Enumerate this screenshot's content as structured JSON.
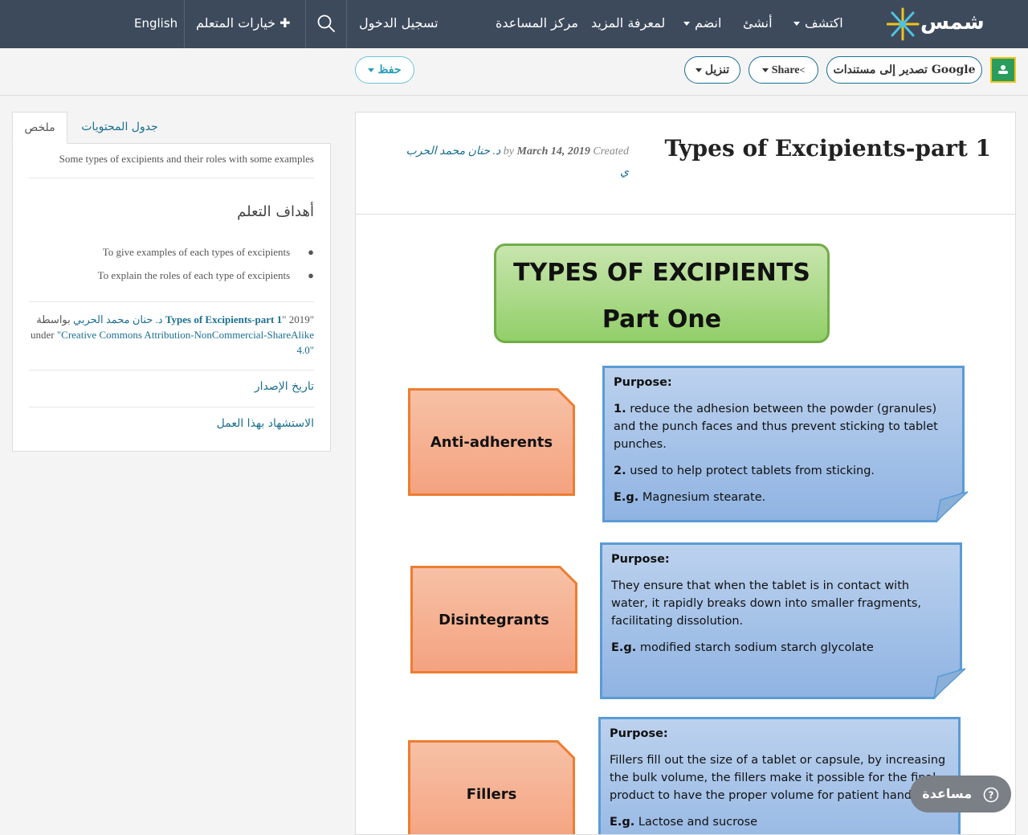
{
  "nav": {
    "logo_text": "شمس",
    "items": {
      "discover": "اكتشف",
      "create": "أنشئ",
      "join": "انضم",
      "learn_more": "لمعرفة المزيد",
      "help_center": "مركز المساعدة",
      "login": "تسجيل الدخول",
      "learner_options": "خيارات المتعلم",
      "language": "English"
    }
  },
  "toolbar": {
    "export_google": "تصدير إلى مستندات Google",
    "share": "Share",
    "download": "تنزيل",
    "save": "حفظ"
  },
  "tabs": {
    "toc": "جدول المحتويات",
    "summary": "ملخص"
  },
  "sidebar": {
    "description": "Some types of excipients and their roles with some examples",
    "objectives_heading": "أهداف التعلم",
    "objectives": [
      "To give examples of each types of excipients",
      "To explain the roles of each type of excipients"
    ],
    "attribution": {
      "quote_open": "\"",
      "title": "Types of Excipients-part 1",
      "by": "بواسطة",
      "author": "د. حنان محمد الحربي",
      "year": "2019",
      "under": "under",
      "license": "\"Creative Commons Attribution-NonCommercial-ShareAlike",
      "license_end": "4.0\""
    },
    "release_history": "تاريخ الإصدار",
    "cite": "الاستشهاد بهذا العمل"
  },
  "resource": {
    "title": "Types of Excipients-part 1",
    "meta_author": "د. حنان محمد الحرب",
    "meta_author_end": "ي",
    "meta_created": "Created",
    "meta_date": "March 14, 2019",
    "meta_by": "by"
  },
  "infographic": {
    "heading_line1": "TYPES OF EXCIPIENTS",
    "heading_line2": "Part One",
    "sections": [
      {
        "name": "Anti-adherents",
        "purpose_label": "Purpose:",
        "items": [
          {
            "num": "1.",
            "text": "reduce the adhesion between the powder (granules) and the punch faces and thus prevent sticking to tablet punches."
          },
          {
            "num": "2.",
            "text": " used to help protect tablets from sticking."
          }
        ],
        "eg_label": "E.g.",
        "eg": "Magnesium stearate."
      },
      {
        "name": "Disintegrants",
        "purpose_label": "Purpose:",
        "text": "They ensure that when the tablet is in contact with water, it rapidly breaks down into smaller fragments, facilitating dissolution.",
        "eg_label": "E.g.",
        "eg": "modified starch sodium starch glycolate"
      },
      {
        "name": "Fillers",
        "purpose_label": "Purpose:",
        "text": "Fillers fill out the size of a tablet or capsule, by increasing the bulk volume, the fillers make it possible for the final product to have the proper volume for patient handling.",
        "eg_label": "E.g.",
        "eg": "Lactose and sucrose"
      }
    ]
  },
  "help": {
    "label": "مساعدة"
  },
  "colors": {
    "nav_bg": "#3d4a5c",
    "link": "#1a6f91",
    "green_box": "#92cf69",
    "orange_box": "#f4a27f",
    "blue_box": "#9dbde6"
  }
}
